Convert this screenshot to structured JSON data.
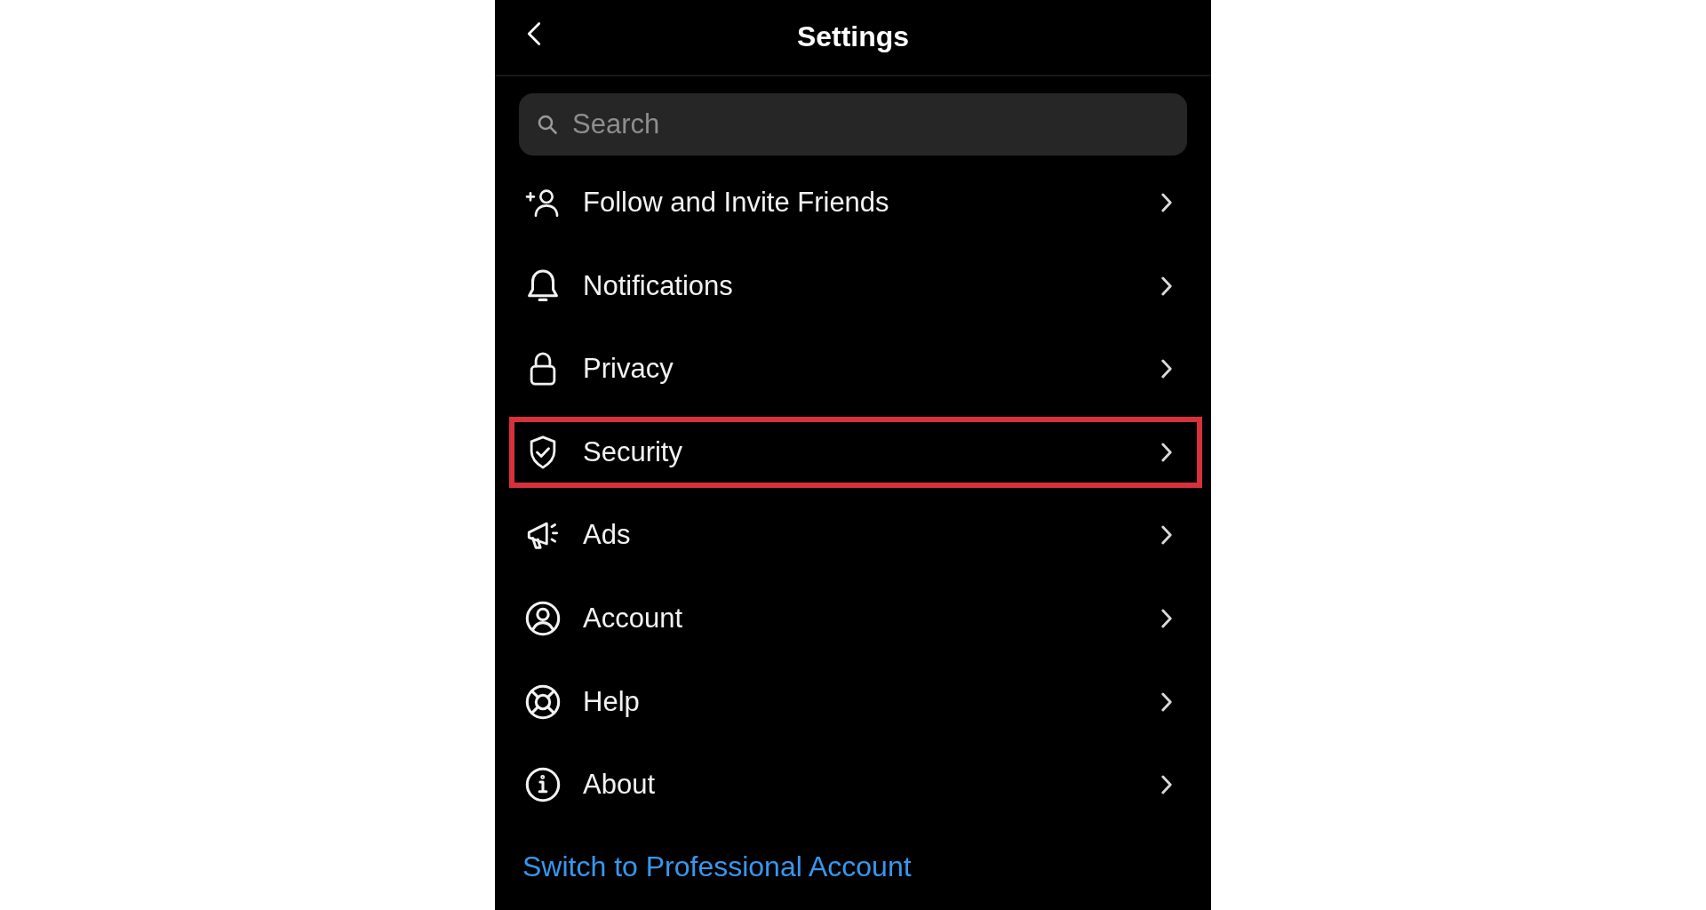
{
  "header": {
    "title": "Settings"
  },
  "search": {
    "placeholder": "Search"
  },
  "items": [
    {
      "label": "Follow and Invite Friends",
      "selected": false
    },
    {
      "label": "Notifications",
      "selected": false
    },
    {
      "label": "Privacy",
      "selected": false
    },
    {
      "label": "Security",
      "selected": true
    },
    {
      "label": "Ads",
      "selected": false
    },
    {
      "label": "Account",
      "selected": false
    },
    {
      "label": "Help",
      "selected": false
    },
    {
      "label": "About",
      "selected": false
    }
  ],
  "link": "Switch to Professional Account"
}
